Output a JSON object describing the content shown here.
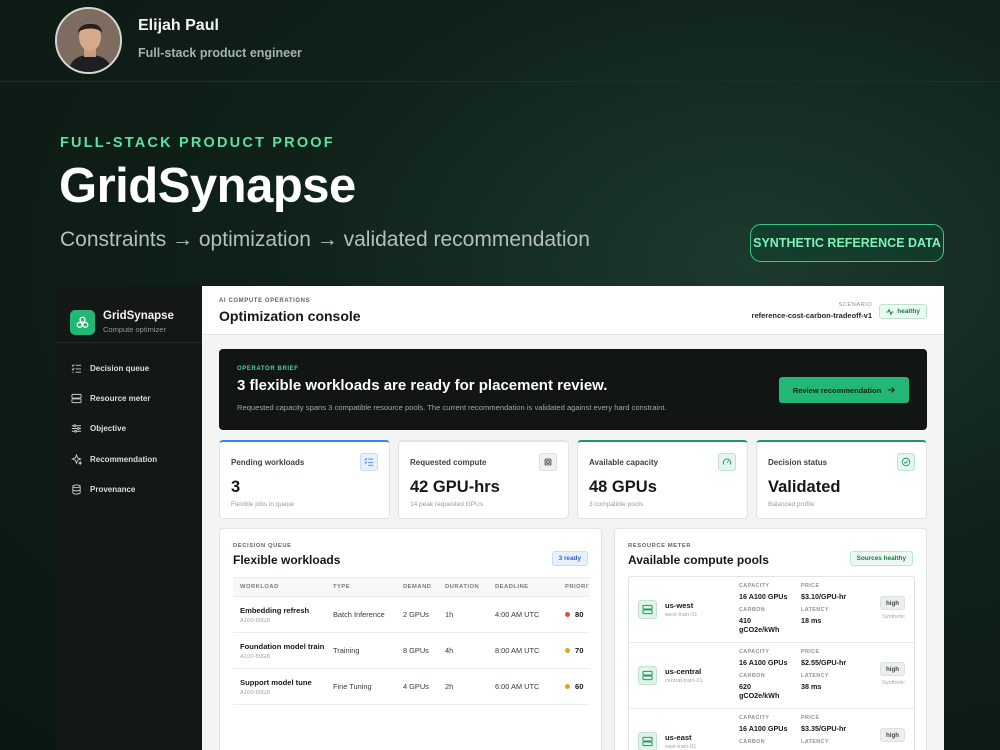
{
  "profile": {
    "name": "Elijah Paul",
    "role": "Full-stack product engineer"
  },
  "hero": {
    "eyebrow": "FULL-STACK PRODUCT PROOF",
    "title": "GridSynapse",
    "subtitle": "Constraints → optimization → validated recommendation",
    "badge": "SYNTHETIC REFERENCE DATA"
  },
  "app": {
    "brand": {
      "name": "GridSynapse",
      "subtitle": "Compute optimizer"
    },
    "nav": [
      {
        "label": "Decision queue",
        "icon": "list-check-icon"
      },
      {
        "label": "Resource meter",
        "icon": "server-icon"
      },
      {
        "label": "Objective",
        "icon": "sliders-icon"
      },
      {
        "label": "Recommendation",
        "icon": "sparkles-icon"
      },
      {
        "label": "Provenance",
        "icon": "database-icon"
      }
    ],
    "topbar": {
      "eyebrow": "AI COMPUTE OPERATIONS",
      "title": "Optimization console",
      "scenario_label": "SCENARIO",
      "scenario_value": "reference-cost-carbon-tradeoff-v1",
      "status": "healthy"
    },
    "brief": {
      "eyebrow": "OPERATOR BRIEF",
      "title": "3 flexible workloads are ready for placement review.",
      "text": "Requested capacity spans 3 compatible resource pools. The current recommendation is validated against every hard constraint.",
      "button": "Review recommendation"
    },
    "kpis": [
      {
        "label": "Pending workloads",
        "value": "3",
        "sub": "Flexible jobs in queue",
        "icon": "list-check-icon",
        "accent": "#3b82f6"
      },
      {
        "label": "Requested compute",
        "value": "42 GPU-hrs",
        "sub": "14 peak requested GPUs",
        "icon": "chip-icon",
        "accent": "#e0e4e2"
      },
      {
        "label": "Available capacity",
        "value": "48 GPUs",
        "sub": "3 compatible pools",
        "icon": "gauge-icon",
        "accent": "#1a9c5f"
      },
      {
        "label": "Decision status",
        "value": "Validated",
        "sub": "Balanced profile",
        "icon": "check-circle-icon",
        "accent": "#1a9c5f"
      }
    ],
    "queue": {
      "eyebrow": "DECISION QUEUE",
      "title": "Flexible workloads",
      "pill": "3 ready",
      "columns": [
        "WORKLOAD",
        "TYPE",
        "DEMAND",
        "DURATION",
        "DEADLINE",
        "PRIORITY"
      ],
      "rows": [
        {
          "name": "Embedding refresh",
          "gpu": "A100-80GB",
          "type": "Batch Inference",
          "demand": "2 GPUs",
          "duration": "1h",
          "deadline": "4:00 AM UTC",
          "priority": "80",
          "priority_color": "#e5484d"
        },
        {
          "name": "Foundation model train",
          "gpu": "A100-80GB",
          "type": "Training",
          "demand": "8 GPUs",
          "duration": "4h",
          "deadline": "8:00 AM UTC",
          "priority": "70",
          "priority_color": "#e8a317"
        },
        {
          "name": "Support model tune",
          "gpu": "A100-80GB",
          "type": "Fine Tuning",
          "demand": "4 GPUs",
          "duration": "2h",
          "deadline": "6:00 AM UTC",
          "priority": "60",
          "priority_color": "#e8a317"
        }
      ]
    },
    "pools": {
      "eyebrow": "RESOURCE METER",
      "title": "Available compute pools",
      "pill": "Sources healthy",
      "labels": {
        "capacity": "CAPACITY",
        "price": "PRICE",
        "carbon": "CARBON",
        "latency": "LATENCY"
      },
      "items": [
        {
          "name": "us-west",
          "zone": "west-train-01",
          "capacity": "16 A100 GPUs",
          "price": "$3.10/GPU-hr",
          "carbon": "410 gCO2e/kWh",
          "latency": "18 ms",
          "tier": "high",
          "tier_sub": "Synthetic"
        },
        {
          "name": "us-central",
          "zone": "central-train-01",
          "capacity": "16 A100 GPUs",
          "price": "$2.55/GPU-hr",
          "carbon": "620 gCO2e/kWh",
          "latency": "38 ms",
          "tier": "high",
          "tier_sub": "Synthetic"
        },
        {
          "name": "us-east",
          "zone": "east-train-01",
          "capacity": "16 A100 GPUs",
          "price": "$3.35/GPU-hr",
          "carbon": "",
          "latency": "",
          "tier": "high",
          "tier_sub": ""
        }
      ]
    }
  }
}
